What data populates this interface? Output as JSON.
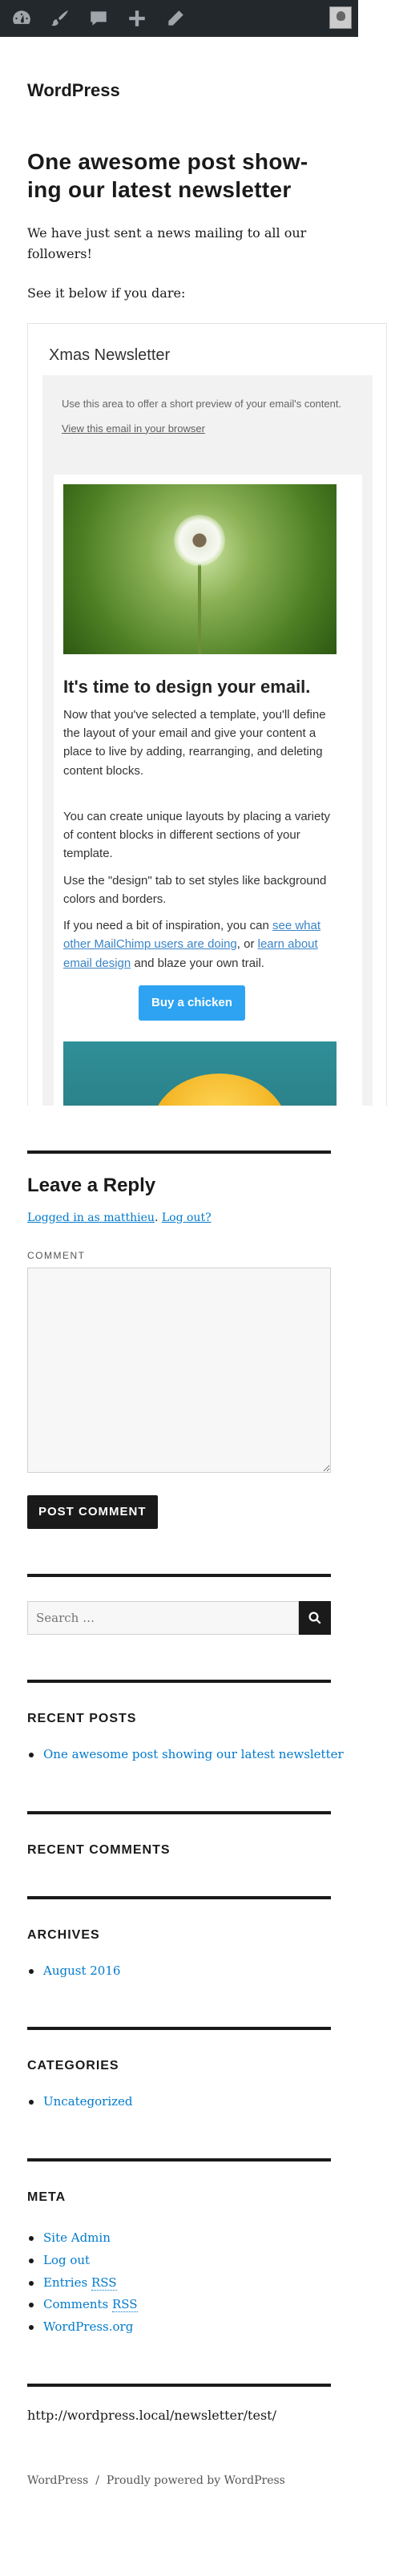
{
  "admin_bar": {
    "icons": [
      "dashboard-icon",
      "customize-brush-icon",
      "comments-icon",
      "new-plus-icon",
      "edit-pencil-icon"
    ]
  },
  "site": {
    "title": "WordPress"
  },
  "post": {
    "title": "One awesome post show-ing our latest newsletter",
    "title_line1": "One awesome post show-",
    "title_line2": "ing our latest newsletter",
    "p1": "We have just sent a news mailing to all our followers!",
    "p2": "See it below if you dare:"
  },
  "newsletter": {
    "heading": "Xmas Newsletter",
    "preheader": "Use this area to offer a short preview of your email's content.",
    "view_link": "View this email in your browser",
    "h2": "It's time to design your email.",
    "para1": "Now that you've selected a template, you'll define the layout of your email and give your content a place to live by adding, rearranging, and deleting content blocks.",
    "para2": "You can create unique layouts by placing a variety of content blocks in different sections of your template.",
    "para3": "Use the \"design\" tab to set styles like background colors and borders.",
    "para4_a": "If you need a bit of inspiration, you can ",
    "para4_link1": "see what other MailChimp users are doing",
    "para4_b": ", or ",
    "para4_link2": "learn about email design",
    "para4_c": " and blaze your own trail.",
    "button": "Buy a chicken"
  },
  "comments": {
    "title": "Leave a Reply",
    "logged_in": "Logged in as matthieu",
    "sep": ". ",
    "logout": "Log out?",
    "comment_label": "COMMENT",
    "submit": "POST COMMENT"
  },
  "search": {
    "placeholder": "Search …"
  },
  "recent_posts": {
    "title": "RECENT POSTS",
    "items": [
      "One awesome post showing our latest newsletter"
    ]
  },
  "recent_comments": {
    "title": "RECENT COMMENTS"
  },
  "archives": {
    "title": "ARCHIVES",
    "items": [
      "August 2016"
    ]
  },
  "categories": {
    "title": "CATEGORIES",
    "items": [
      "Uncategorized"
    ]
  },
  "meta": {
    "title": "META",
    "items": [
      "Site Admin",
      "Log out",
      "Entries",
      "Comments",
      "WordPress.org"
    ],
    "rss": "RSS"
  },
  "url_line": "http://wordpress.local/newsletter/test/",
  "footer": {
    "site": "WordPress",
    "sep": "/",
    "powered": "Proudly powered by WordPress"
  },
  "colors": {
    "link": "#007acc",
    "button": "#2ea3f2",
    "adminbar": "#23282d"
  }
}
